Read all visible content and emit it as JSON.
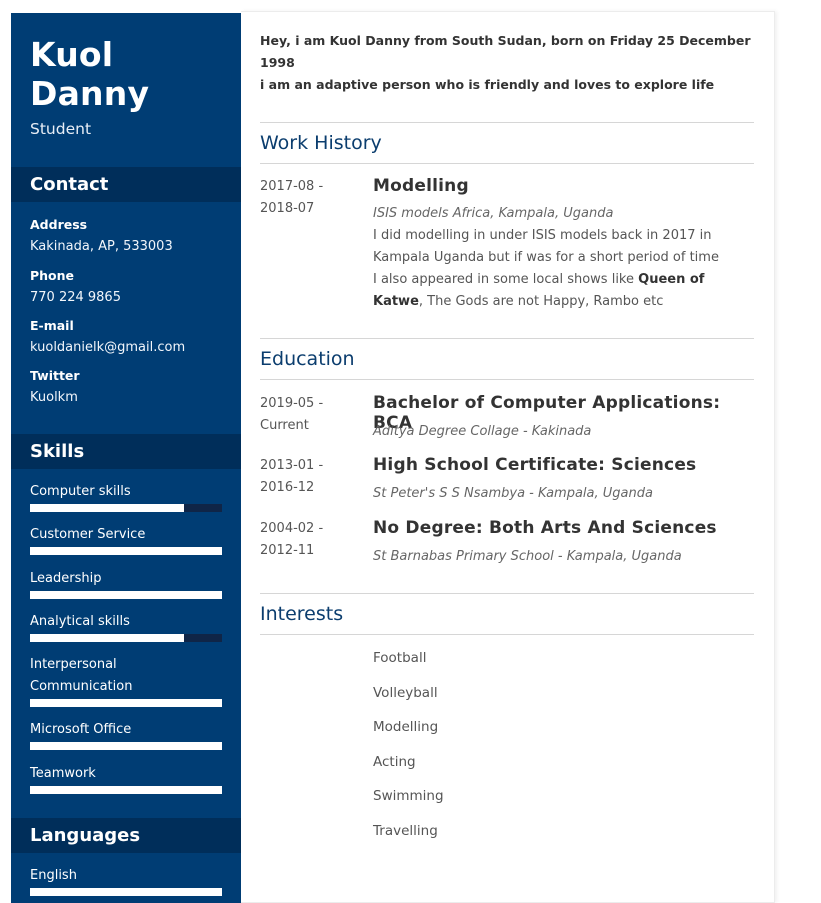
{
  "profile": {
    "first_name": "Kuol",
    "last_name": "Danny",
    "role": "Student"
  },
  "contact": {
    "heading": "Contact",
    "address_label": "Address",
    "address": "Kakinada, AP, 533003",
    "phone_label": "Phone",
    "phone": "770 224 9865",
    "email_label": "E-mail",
    "email": "kuoldanielk@gmail.com",
    "twitter_label": "Twitter",
    "twitter": "Kuolkm"
  },
  "skills": {
    "heading": "Skills",
    "items": [
      {
        "name": "Computer skills",
        "level": 0.8
      },
      {
        "name": "Customer Service",
        "level": 1.0
      },
      {
        "name": "Leadership",
        "level": 1.0
      },
      {
        "name": "Analytical skills",
        "level": 0.8
      },
      {
        "name": "Interpersonal Communication",
        "level": 1.0
      },
      {
        "name": "Microsoft Office",
        "level": 1.0
      },
      {
        "name": "Teamwork",
        "level": 1.0
      }
    ]
  },
  "languages": {
    "heading": "Languages",
    "items": [
      {
        "name": "English",
        "level": 1.0
      }
    ]
  },
  "intro": {
    "line1": "Hey, i am Kuol Danny from South Sudan, born on Friday 25 December 1998",
    "line2": "i am an adaptive person who is friendly and loves to explore life"
  },
  "work": {
    "heading": "Work History",
    "items": [
      {
        "date_start": "2017-08 -",
        "date_end": "2018-07",
        "title": "Modelling",
        "subtitle": "ISIS models Africa, Kampala, Uganda",
        "desc1": "I did modelling in under ISIS models back in 2017 in Kampala Uganda but if was for a short period of time",
        "desc2_pre": "I also appeared in some local shows like ",
        "desc2_bold": "Queen of Katwe",
        "desc2_post": ", The Gods are not Happy, Rambo etc"
      }
    ]
  },
  "education": {
    "heading": "Education",
    "items": [
      {
        "date_start": "2019-05 -",
        "date_end": "Current",
        "title": "Bachelor of Computer Applications: BCA",
        "subtitle": "Aditya Degree Collage - Kakinada"
      },
      {
        "date_start": "2013-01 -",
        "date_end": "2016-12",
        "title": "High School Certificate: Sciences",
        "subtitle": "St Peter's S S Nsambya - Kampala, Uganda"
      },
      {
        "date_start": "2004-02 -",
        "date_end": "2012-11",
        "title": "No Degree: Both Arts And Sciences",
        "subtitle": "St Barnabas Primary School - Kampala, Uganda"
      }
    ]
  },
  "interests": {
    "heading": "Interests",
    "items": [
      "Football",
      "Volleyball",
      "Modelling",
      "Acting",
      "Swimming",
      "Travelling"
    ]
  },
  "colors": {
    "sidebar": "#003d74",
    "sidebar_heading": "#002e5a",
    "accent_title": "#0b3d6e"
  }
}
